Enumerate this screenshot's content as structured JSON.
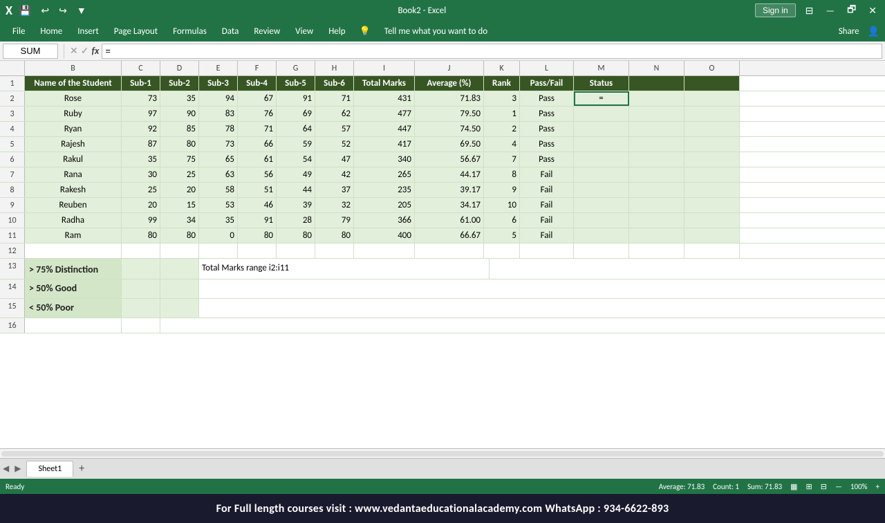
{
  "titlebar": {
    "title": "Book2 - Excel",
    "save_icon": "💾",
    "undo_icon": "↩",
    "redo_icon": "↪",
    "customize_icon": "▼",
    "signin_label": "Sign in",
    "minimize": "—",
    "restore": "🗗",
    "close": "✕"
  },
  "menubar": {
    "items": [
      "File",
      "Home",
      "Insert",
      "Page Layout",
      "Formulas",
      "Data",
      "Review",
      "View",
      "Help",
      "Tell me what you want to do",
      "Share"
    ]
  },
  "formulabar": {
    "namebox": "SUM",
    "cancel": "✕",
    "confirm": "✓",
    "fx": "fx",
    "formula": "="
  },
  "columns": {
    "letters": [
      "",
      "B",
      "C",
      "D",
      "E",
      "F",
      "G",
      "H",
      "I",
      "J",
      "K",
      "L",
      "M",
      "N",
      "O"
    ]
  },
  "header_row": {
    "row_num": "1",
    "cells": [
      "Name of the Student",
      "Sub-1",
      "Sub-2",
      "Sub-3",
      "Sub-4",
      "Sub-5",
      "Sub-6",
      "Total Marks",
      "Average (%)",
      "Rank",
      "Pass/Fail",
      "Status",
      "",
      ""
    ]
  },
  "data_rows": [
    {
      "row": "2",
      "cells": [
        "Rose",
        "73",
        "35",
        "94",
        "67",
        "91",
        "71",
        "431",
        "71.83",
        "3",
        "Pass",
        "=",
        "",
        ""
      ]
    },
    {
      "row": "3",
      "cells": [
        "Ruby",
        "97",
        "90",
        "83",
        "76",
        "69",
        "62",
        "477",
        "79.50",
        "1",
        "Pass",
        "",
        "",
        ""
      ]
    },
    {
      "row": "4",
      "cells": [
        "Ryan",
        "92",
        "85",
        "78",
        "71",
        "64",
        "57",
        "447",
        "74.50",
        "2",
        "Pass",
        "",
        "",
        ""
      ]
    },
    {
      "row": "5",
      "cells": [
        "Rajesh",
        "87",
        "80",
        "73",
        "66",
        "59",
        "52",
        "417",
        "69.50",
        "4",
        "Pass",
        "",
        "",
        ""
      ]
    },
    {
      "row": "6",
      "cells": [
        "Rakul",
        "35",
        "75",
        "65",
        "61",
        "54",
        "47",
        "340",
        "56.67",
        "7",
        "Pass",
        "",
        "",
        ""
      ]
    },
    {
      "row": "7",
      "cells": [
        "Rana",
        "30",
        "25",
        "63",
        "56",
        "49",
        "42",
        "265",
        "44.17",
        "8",
        "Fail",
        "",
        "",
        ""
      ]
    },
    {
      "row": "8",
      "cells": [
        "Rakesh",
        "25",
        "20",
        "58",
        "51",
        "44",
        "37",
        "235",
        "39.17",
        "9",
        "Fail",
        "",
        "",
        ""
      ]
    },
    {
      "row": "9",
      "cells": [
        "Reuben",
        "20",
        "15",
        "53",
        "46",
        "39",
        "32",
        "205",
        "34.17",
        "10",
        "Fail",
        "",
        "",
        ""
      ]
    },
    {
      "row": "10",
      "cells": [
        "Radha",
        "99",
        "34",
        "35",
        "91",
        "28",
        "79",
        "366",
        "61.00",
        "6",
        "Fail",
        "",
        "",
        ""
      ]
    },
    {
      "row": "11",
      "cells": [
        "Ram",
        "80",
        "80",
        "0",
        "80",
        "80",
        "80",
        "400",
        "66.67",
        "5",
        "Fail",
        "",
        "",
        ""
      ]
    }
  ],
  "blank_row_12": {
    "row": "12"
  },
  "note_rows": [
    {
      "row": "13",
      "note_col": "> 75% Distinction",
      "rest": "Total Marks range i2:i11"
    },
    {
      "row": "14",
      "note_col": "> 50% Good",
      "rest": ""
    },
    {
      "row": "15",
      "note_col": "< 50% Poor",
      "rest": ""
    }
  ],
  "blank_row_16": {
    "row": "16"
  },
  "sheet_tabs": {
    "active": "Sheet1",
    "nav_left": "◀",
    "nav_right": "▶"
  },
  "status_bar": {
    "left": "Ready",
    "right_items": [
      "Average: 71.83",
      "Count: 1",
      "Sum: 71.83"
    ]
  },
  "bottom_banner": {
    "text": "For Full length courses visit : www.vedantaeducationalacademy.com          WhatsApp : 934-6622-893"
  }
}
